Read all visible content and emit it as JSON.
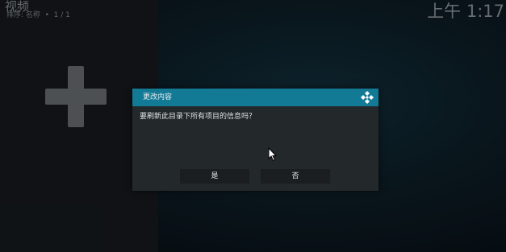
{
  "header": {
    "title": "视频",
    "subtitle": "排序: 名称  •  1 / 1"
  },
  "clock": "上午 1:17",
  "background": {
    "add_icon": "plus-icon"
  },
  "dialog": {
    "title": "更改内容",
    "logo_icon": "kodi-logo-icon",
    "message": "要刷新此目录下所有项目的信息吗？",
    "buttons": {
      "yes_label": "是",
      "no_label": "否"
    }
  },
  "colors": {
    "dialog_header": "#137a96",
    "dialog_body": "#23282b",
    "button_bg": "#1a1e20"
  },
  "cursor": "mouse-pointer-icon"
}
